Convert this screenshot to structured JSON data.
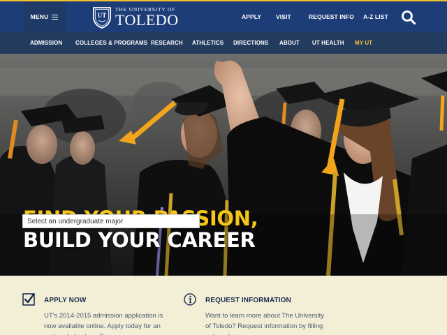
{
  "header": {
    "menu_label": "MENU",
    "logo_line1": "THE UNIVERSITY OF",
    "logo_line2": "TOLEDO",
    "logo_shield_text": "UT",
    "utility_links": [
      "APPLY",
      "VISIT",
      "REQUEST INFO",
      "A-Z LIST"
    ],
    "search_icon": "search-icon"
  },
  "nav": {
    "items": [
      "ADMISSION",
      "COLLEGES & PROGRAMS",
      "RESEARCH",
      "ATHLETICS",
      "DIRECTIONS",
      "ABOUT",
      "UT HEALTH",
      "MY UT"
    ]
  },
  "hero": {
    "headline_line1": "FIND YOUR PASSION,",
    "headline_line2": "BUILD YOUR CAREER",
    "major_select_value": "Select an undergraduate major"
  },
  "info": {
    "apply": {
      "icon": "checkbox-icon",
      "title": "APPLY NOW",
      "body": "UT's 2014-2015 admission application is now available online. Apply today for an early scholarship offer."
    },
    "request": {
      "icon": "info-icon",
      "title": "REQUEST INFORMATION",
      "body": "Want to learn more about The University of Toledo? Request information by filling out our fast"
    }
  },
  "colors": {
    "brand_blue": "#1d3d78",
    "nav_blue": "#233b5f",
    "gold": "#f2c12e",
    "cream": "#f3efd6"
  }
}
